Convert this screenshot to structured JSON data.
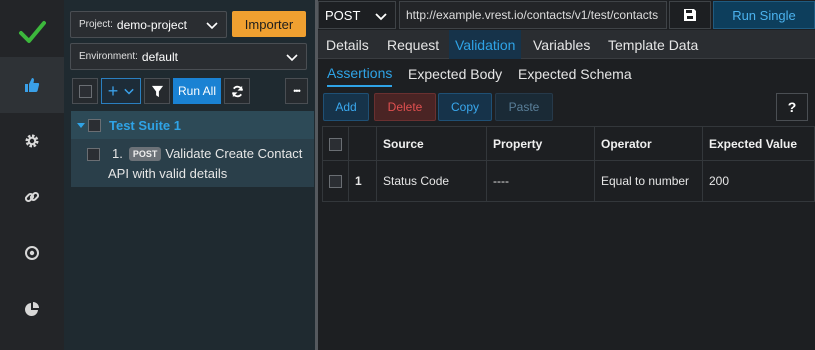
{
  "sidebar": {
    "icons": [
      "check-icon",
      "thumbs-up-icon",
      "gear-icon",
      "link-icon",
      "target-icon",
      "pie-chart-icon"
    ],
    "accent_check": "#3cb83c"
  },
  "project": {
    "label": "Project:",
    "value": "demo-project"
  },
  "importer_label": "Importer",
  "environment": {
    "label": "Environment:",
    "value": "default"
  },
  "toolbar": {
    "add_symbol": "+",
    "run_all_label": "Run All",
    "more_symbol": "•••"
  },
  "suite": {
    "title": "Test Suite 1"
  },
  "testcase": {
    "number": "1.",
    "method_badge": "POST",
    "title_line1": "Validate Create Contact",
    "title_line2": "API with valid details"
  },
  "request": {
    "method": "POST",
    "url": "http://example.vrest.io/contacts/v1/test/contacts",
    "run_single_label": "Run Single"
  },
  "tabs": [
    {
      "label": "Details"
    },
    {
      "label": "Request"
    },
    {
      "label": "Validation",
      "active": true
    },
    {
      "label": "Variables"
    },
    {
      "label": "Template Data"
    }
  ],
  "subtabs": [
    {
      "label": "Assertions",
      "active": true
    },
    {
      "label": "Expected Body"
    },
    {
      "label": "Expected Schema"
    }
  ],
  "actions": {
    "add": "Add",
    "delete": "Delete",
    "copy": "Copy",
    "paste": "Paste",
    "help": "?"
  },
  "table": {
    "headers": [
      "Source",
      "Property",
      "Operator",
      "Expected Value"
    ],
    "rows": [
      {
        "num": "1",
        "source": "Status Code",
        "property": "----",
        "operator": "Equal to number",
        "expected": "200"
      }
    ]
  },
  "colors": {
    "accent_blue": "#2fa3e6",
    "importer_orange": "#f0a030",
    "delete_red": "#e05050"
  }
}
